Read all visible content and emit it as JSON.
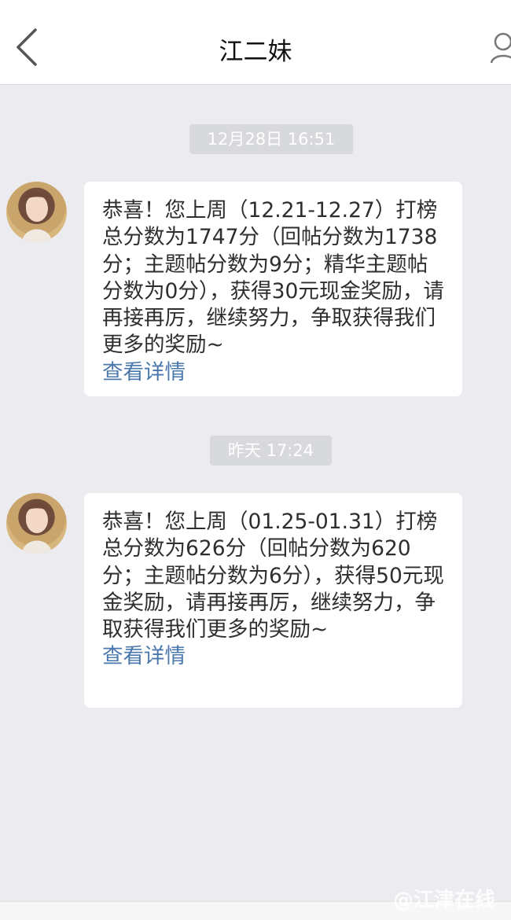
{
  "header": {
    "title": "江二妹"
  },
  "messages": [
    {
      "time": "12月28日 16:51",
      "text": "恭喜！您上周（12.21-12.27）打榜总分数为1747分（回帖分数为1738分；主题帖分数为9分；精华主题帖分数为0分），获得30元现金奖励，请再接再厉，继续努力，争取获得我们更多的奖励~",
      "detail": "查看详情"
    },
    {
      "time": "昨天 17:24",
      "text": "恭喜！您上周（01.25-01.31）打榜总分数为626分（回帖分数为620分；主题帖分数为6分），获得50元现金奖励，请再接再厉，继续努力，争取获得我们更多的奖励~",
      "detail": "查看详情"
    }
  ],
  "watermark": "@江津在线",
  "icons": [
    "back-chevron-icon",
    "profile-icon"
  ]
}
